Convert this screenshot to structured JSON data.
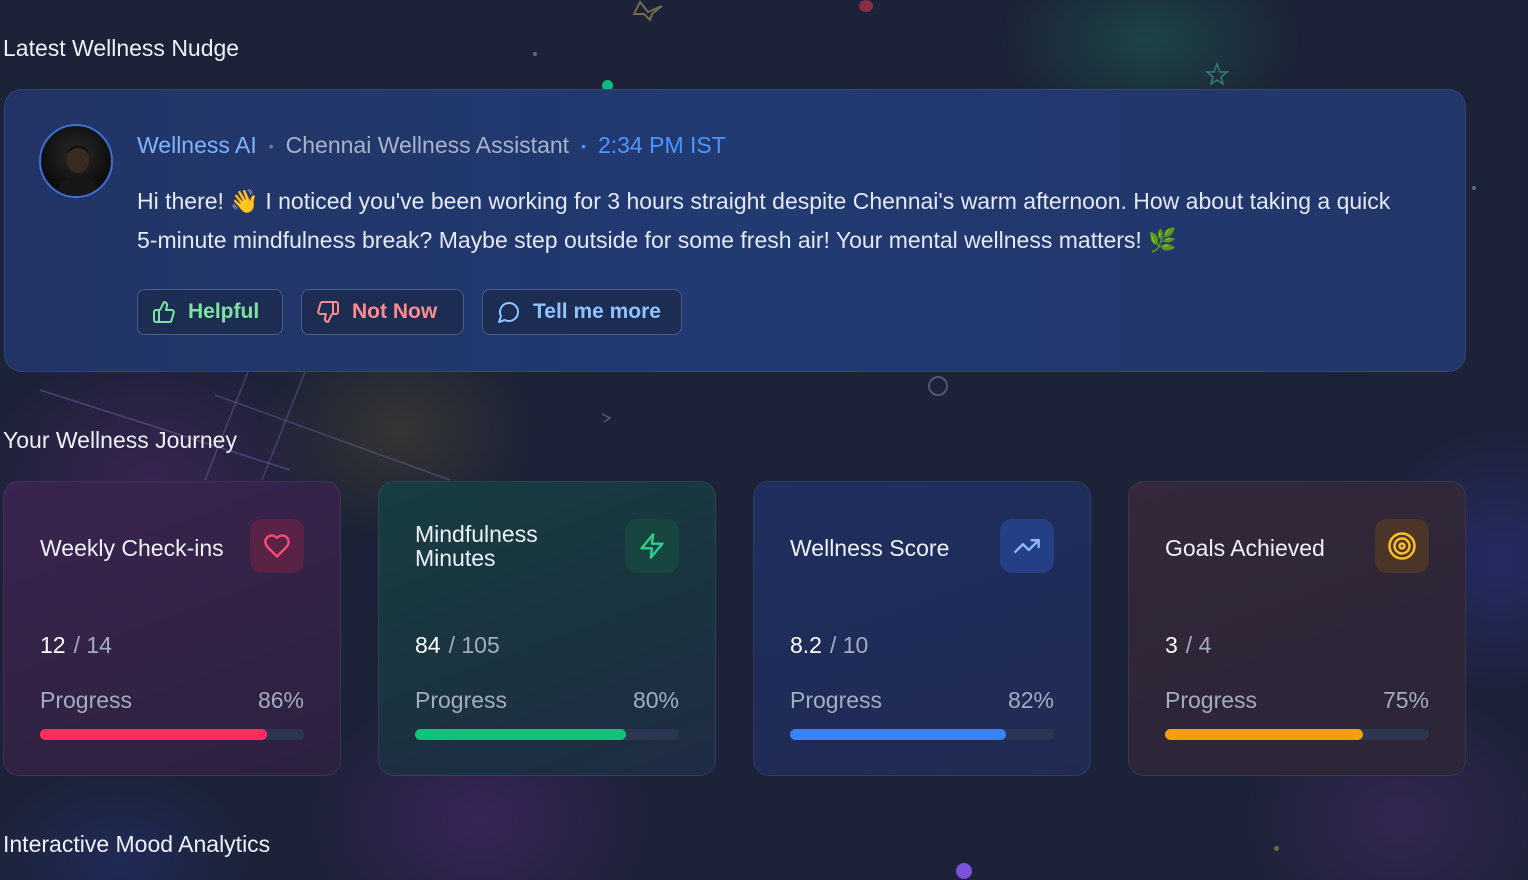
{
  "sections": {
    "nudge_title": "Latest Wellness Nudge",
    "journey_title": "Your Wellness Journey",
    "analytics_title": "Interactive Mood Analytics"
  },
  "nudge": {
    "sender": "Wellness AI",
    "separator": "•",
    "role": "Chennai Wellness Assistant",
    "time": "2:34 PM IST",
    "message": "Hi there! 👋 I noticed you've been working for 3 hours straight despite Chennai's warm afternoon. How about taking a quick 5-minute mindfulness break? Maybe step outside for some fresh air! Your mental wellness matters! 🌿",
    "buttons": {
      "helpful": "Helpful",
      "not_now": "Not Now",
      "tell_more": "Tell me more"
    },
    "colors": {
      "helpful": "#7ee2a0",
      "not_now": "#ff8c8c",
      "tell_more": "#8ec4ff"
    }
  },
  "stats": [
    {
      "title": "Weekly Check-ins",
      "icon": "heart-icon",
      "value": "12",
      "total": "/ 14",
      "progress_label": "Progress",
      "percent": "86%",
      "fill": 0.86,
      "color": "#ff2d5e"
    },
    {
      "title": "Mindfulness Minutes",
      "icon": "lightning-icon",
      "value": "84",
      "total": "/ 105",
      "progress_label": "Progress",
      "percent": "80%",
      "fill": 0.8,
      "color": "#10c27c"
    },
    {
      "title": "Wellness Score",
      "icon": "trending-up-icon",
      "value": "8.2",
      "total": "/ 10",
      "progress_label": "Progress",
      "percent": "82%",
      "fill": 0.82,
      "color": "#3b82f6"
    },
    {
      "title": "Goals Achieved",
      "icon": "target-icon",
      "value": "3",
      "total": "/ 4",
      "progress_label": "Progress",
      "percent": "75%",
      "fill": 0.75,
      "color": "#f59e0b"
    }
  ]
}
